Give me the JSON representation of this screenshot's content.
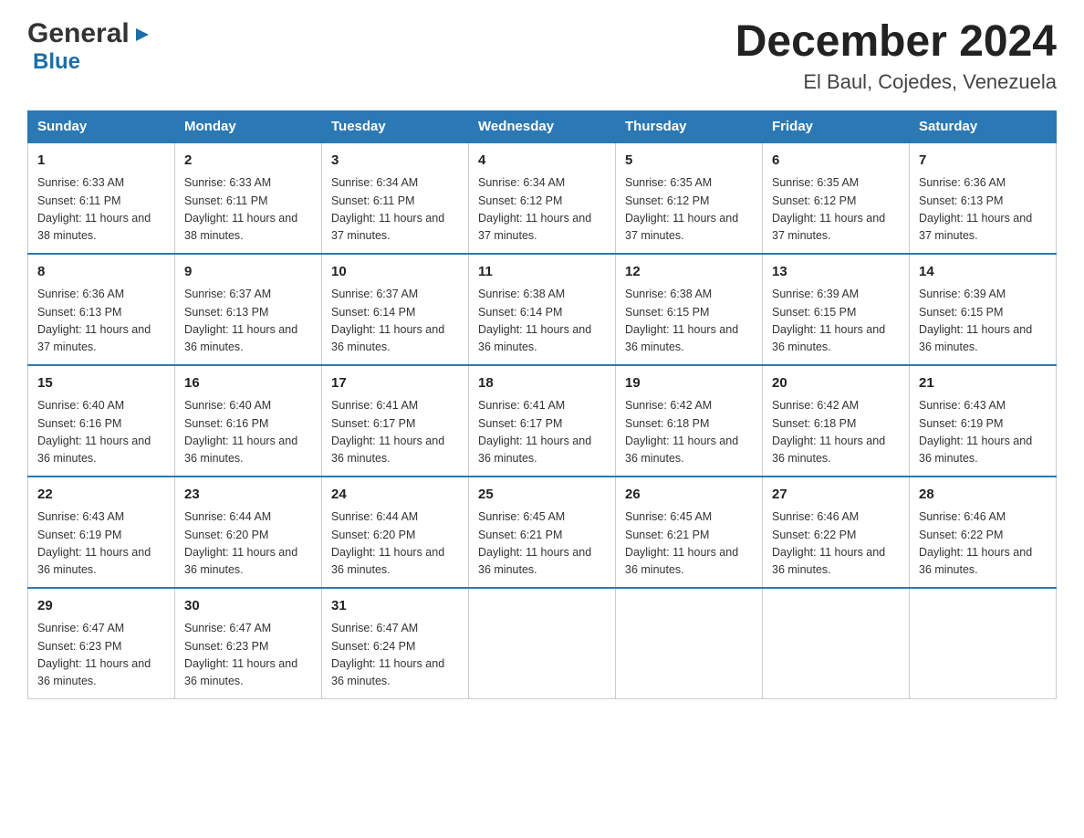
{
  "header": {
    "logo_general": "General",
    "logo_blue": "Blue",
    "month_title": "December 2024",
    "location": "El Baul, Cojedes, Venezuela"
  },
  "days_of_week": [
    "Sunday",
    "Monday",
    "Tuesday",
    "Wednesday",
    "Thursday",
    "Friday",
    "Saturday"
  ],
  "weeks": [
    [
      {
        "day": "1",
        "sunrise": "Sunrise: 6:33 AM",
        "sunset": "Sunset: 6:11 PM",
        "daylight": "Daylight: 11 hours and 38 minutes."
      },
      {
        "day": "2",
        "sunrise": "Sunrise: 6:33 AM",
        "sunset": "Sunset: 6:11 PM",
        "daylight": "Daylight: 11 hours and 38 minutes."
      },
      {
        "day": "3",
        "sunrise": "Sunrise: 6:34 AM",
        "sunset": "Sunset: 6:11 PM",
        "daylight": "Daylight: 11 hours and 37 minutes."
      },
      {
        "day": "4",
        "sunrise": "Sunrise: 6:34 AM",
        "sunset": "Sunset: 6:12 PM",
        "daylight": "Daylight: 11 hours and 37 minutes."
      },
      {
        "day": "5",
        "sunrise": "Sunrise: 6:35 AM",
        "sunset": "Sunset: 6:12 PM",
        "daylight": "Daylight: 11 hours and 37 minutes."
      },
      {
        "day": "6",
        "sunrise": "Sunrise: 6:35 AM",
        "sunset": "Sunset: 6:12 PM",
        "daylight": "Daylight: 11 hours and 37 minutes."
      },
      {
        "day": "7",
        "sunrise": "Sunrise: 6:36 AM",
        "sunset": "Sunset: 6:13 PM",
        "daylight": "Daylight: 11 hours and 37 minutes."
      }
    ],
    [
      {
        "day": "8",
        "sunrise": "Sunrise: 6:36 AM",
        "sunset": "Sunset: 6:13 PM",
        "daylight": "Daylight: 11 hours and 37 minutes."
      },
      {
        "day": "9",
        "sunrise": "Sunrise: 6:37 AM",
        "sunset": "Sunset: 6:13 PM",
        "daylight": "Daylight: 11 hours and 36 minutes."
      },
      {
        "day": "10",
        "sunrise": "Sunrise: 6:37 AM",
        "sunset": "Sunset: 6:14 PM",
        "daylight": "Daylight: 11 hours and 36 minutes."
      },
      {
        "day": "11",
        "sunrise": "Sunrise: 6:38 AM",
        "sunset": "Sunset: 6:14 PM",
        "daylight": "Daylight: 11 hours and 36 minutes."
      },
      {
        "day": "12",
        "sunrise": "Sunrise: 6:38 AM",
        "sunset": "Sunset: 6:15 PM",
        "daylight": "Daylight: 11 hours and 36 minutes."
      },
      {
        "day": "13",
        "sunrise": "Sunrise: 6:39 AM",
        "sunset": "Sunset: 6:15 PM",
        "daylight": "Daylight: 11 hours and 36 minutes."
      },
      {
        "day": "14",
        "sunrise": "Sunrise: 6:39 AM",
        "sunset": "Sunset: 6:15 PM",
        "daylight": "Daylight: 11 hours and 36 minutes."
      }
    ],
    [
      {
        "day": "15",
        "sunrise": "Sunrise: 6:40 AM",
        "sunset": "Sunset: 6:16 PM",
        "daylight": "Daylight: 11 hours and 36 minutes."
      },
      {
        "day": "16",
        "sunrise": "Sunrise: 6:40 AM",
        "sunset": "Sunset: 6:16 PM",
        "daylight": "Daylight: 11 hours and 36 minutes."
      },
      {
        "day": "17",
        "sunrise": "Sunrise: 6:41 AM",
        "sunset": "Sunset: 6:17 PM",
        "daylight": "Daylight: 11 hours and 36 minutes."
      },
      {
        "day": "18",
        "sunrise": "Sunrise: 6:41 AM",
        "sunset": "Sunset: 6:17 PM",
        "daylight": "Daylight: 11 hours and 36 minutes."
      },
      {
        "day": "19",
        "sunrise": "Sunrise: 6:42 AM",
        "sunset": "Sunset: 6:18 PM",
        "daylight": "Daylight: 11 hours and 36 minutes."
      },
      {
        "day": "20",
        "sunrise": "Sunrise: 6:42 AM",
        "sunset": "Sunset: 6:18 PM",
        "daylight": "Daylight: 11 hours and 36 minutes."
      },
      {
        "day": "21",
        "sunrise": "Sunrise: 6:43 AM",
        "sunset": "Sunset: 6:19 PM",
        "daylight": "Daylight: 11 hours and 36 minutes."
      }
    ],
    [
      {
        "day": "22",
        "sunrise": "Sunrise: 6:43 AM",
        "sunset": "Sunset: 6:19 PM",
        "daylight": "Daylight: 11 hours and 36 minutes."
      },
      {
        "day": "23",
        "sunrise": "Sunrise: 6:44 AM",
        "sunset": "Sunset: 6:20 PM",
        "daylight": "Daylight: 11 hours and 36 minutes."
      },
      {
        "day": "24",
        "sunrise": "Sunrise: 6:44 AM",
        "sunset": "Sunset: 6:20 PM",
        "daylight": "Daylight: 11 hours and 36 minutes."
      },
      {
        "day": "25",
        "sunrise": "Sunrise: 6:45 AM",
        "sunset": "Sunset: 6:21 PM",
        "daylight": "Daylight: 11 hours and 36 minutes."
      },
      {
        "day": "26",
        "sunrise": "Sunrise: 6:45 AM",
        "sunset": "Sunset: 6:21 PM",
        "daylight": "Daylight: 11 hours and 36 minutes."
      },
      {
        "day": "27",
        "sunrise": "Sunrise: 6:46 AM",
        "sunset": "Sunset: 6:22 PM",
        "daylight": "Daylight: 11 hours and 36 minutes."
      },
      {
        "day": "28",
        "sunrise": "Sunrise: 6:46 AM",
        "sunset": "Sunset: 6:22 PM",
        "daylight": "Daylight: 11 hours and 36 minutes."
      }
    ],
    [
      {
        "day": "29",
        "sunrise": "Sunrise: 6:47 AM",
        "sunset": "Sunset: 6:23 PM",
        "daylight": "Daylight: 11 hours and 36 minutes."
      },
      {
        "day": "30",
        "sunrise": "Sunrise: 6:47 AM",
        "sunset": "Sunset: 6:23 PM",
        "daylight": "Daylight: 11 hours and 36 minutes."
      },
      {
        "day": "31",
        "sunrise": "Sunrise: 6:47 AM",
        "sunset": "Sunset: 6:24 PM",
        "daylight": "Daylight: 11 hours and 36 minutes."
      },
      null,
      null,
      null,
      null
    ]
  ]
}
